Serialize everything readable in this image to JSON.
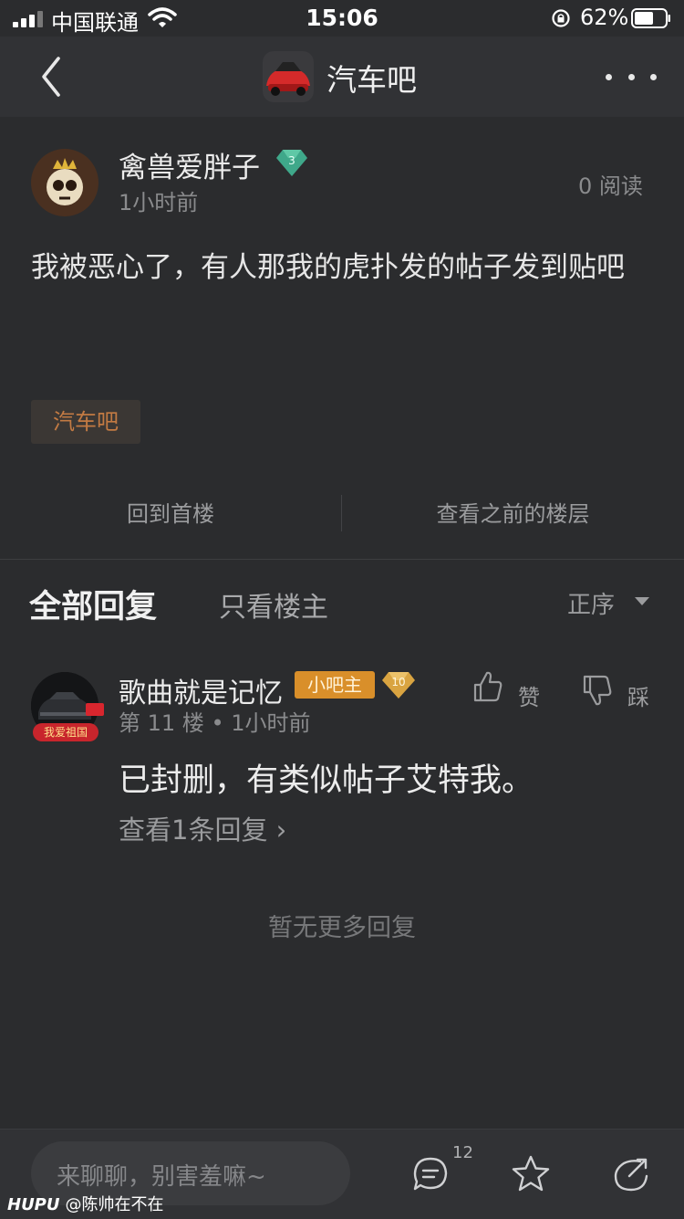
{
  "status_bar": {
    "carrier": "中国联通",
    "time": "15:06",
    "battery": "62%"
  },
  "nav": {
    "title": "汽车吧"
  },
  "post": {
    "author": "禽兽爱胖子",
    "level": "3",
    "time": "1小时前",
    "reads": "0 阅读",
    "content": "我被恶心了，有人那我的虎扑发的帖子发到贴吧",
    "tag": "汽车吧",
    "back_to_first": "回到首楼",
    "view_previous": "查看之前的楼层"
  },
  "replies_header": {
    "all_tab": "全部回复",
    "op_only_tab": "只看楼主",
    "sort": "正序"
  },
  "reply": {
    "author": "歌曲就是记忆",
    "badge": "小吧主",
    "level": "10",
    "avatar_badge": "我爱祖国",
    "floor": "第 11 楼",
    "time": "1小时前",
    "like_label": "赞",
    "dislike_label": "踩",
    "content": "已封删，有类似帖子艾特我。",
    "view_replies": "查看1条回复 ›"
  },
  "no_more": "暂无更多回复",
  "bottom": {
    "placeholder": "来聊聊，别害羞嘛~",
    "comment_count": "12"
  },
  "watermark": {
    "brand": "HUPU",
    "user": "@陈帅在不在"
  },
  "colors": {
    "background": "#2b2c2e",
    "bar": "#313235",
    "tag_text": "#c27a43",
    "mod_badge": "#d98f2a",
    "level_gem_green": "#3fa88a",
    "level_gem_gold": "#d9a441"
  },
  "icons": [
    "back-icon",
    "more-icon",
    "comment-icon",
    "star-icon",
    "share-icon",
    "thumbs-up-icon",
    "thumbs-down-icon",
    "wifi-icon",
    "battery-icon"
  ]
}
